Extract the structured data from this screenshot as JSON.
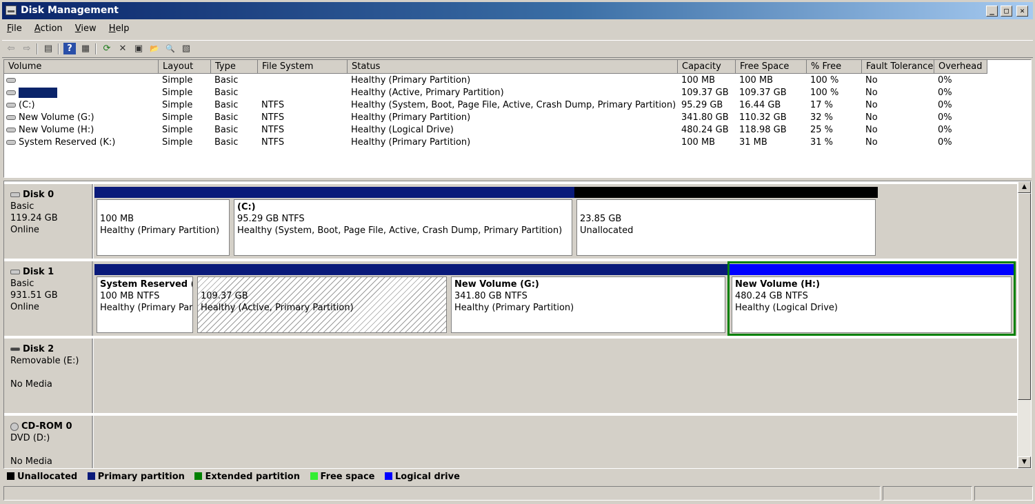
{
  "window": {
    "title": "Disk Management",
    "minimize": "_",
    "maximize": "□",
    "close": "✕"
  },
  "menu": [
    {
      "label": "File",
      "accel": "F",
      "rest": "ile"
    },
    {
      "label": "Action",
      "accel": "A",
      "rest": "ction"
    },
    {
      "label": "View",
      "accel": "V",
      "rest": "iew"
    },
    {
      "label": "Help",
      "accel": "H",
      "rest": "elp"
    }
  ],
  "toolbar": {
    "icons": [
      "back-icon",
      "forward-icon",
      "console-tree-icon",
      "help-icon",
      "properties-pane-icon",
      "refresh-icon",
      "delete-icon",
      "properties-icon",
      "open-icon",
      "explore-icon",
      "help-topics-icon"
    ],
    "glyphs": {
      "back": "⇦",
      "forward": "⇨",
      "tree": "▤",
      "help": "?",
      "pane": "▦",
      "refresh": "⟳",
      "delete": "✕",
      "props": "▣",
      "open": "📂",
      "explore": "🔍",
      "topics": "▧"
    }
  },
  "volume_table": {
    "columns": [
      "Volume",
      "Layout",
      "Type",
      "File System",
      "Status",
      "Capacity",
      "Free Space",
      "% Free",
      "Fault Tolerance",
      "Overhead"
    ],
    "rows": [
      {
        "volume": "",
        "layout": "Simple",
        "type": "Basic",
        "fs": "",
        "status": "Healthy (Primary Partition)",
        "capacity": "100 MB",
        "free": "100 MB",
        "pct": "100 %",
        "fault": "No",
        "overhead": "0%"
      },
      {
        "volume": "",
        "layout": "Simple",
        "type": "Basic",
        "fs": "",
        "status": "Healthy (Active, Primary Partition)",
        "capacity": "109.37 GB",
        "free": "109.37 GB",
        "pct": "100 %",
        "fault": "No",
        "overhead": "0%"
      },
      {
        "volume": "(C:)",
        "layout": "Simple",
        "type": "Basic",
        "fs": "NTFS",
        "status": "Healthy (System, Boot, Page File, Active, Crash Dump, Primary Partition)",
        "capacity": "95.29 GB",
        "free": "16.44 GB",
        "pct": "17 %",
        "fault": "No",
        "overhead": "0%"
      },
      {
        "volume": "New Volume (G:)",
        "layout": "Simple",
        "type": "Basic",
        "fs": "NTFS",
        "status": "Healthy (Primary Partition)",
        "capacity": "341.80 GB",
        "free": "110.32 GB",
        "pct": "32 %",
        "fault": "No",
        "overhead": "0%"
      },
      {
        "volume": "New Volume (H:)",
        "layout": "Simple",
        "type": "Basic",
        "fs": "NTFS",
        "status": "Healthy (Logical Drive)",
        "capacity": "480.24 GB",
        "free": "118.98 GB",
        "pct": "25 %",
        "fault": "No",
        "overhead": "0%"
      },
      {
        "volume": "System Reserved (K:)",
        "layout": "Simple",
        "type": "Basic",
        "fs": "NTFS",
        "status": "Healthy (Primary Partition)",
        "capacity": "100 MB",
        "free": "31 MB",
        "pct": "31 %",
        "fault": "No",
        "overhead": "0%"
      }
    ]
  },
  "disks": [
    {
      "name": "Disk 0",
      "line1": "Basic",
      "line2": "119.24 GB",
      "line3": "Online",
      "partitions": [
        {
          "name": "",
          "size": "100 MB",
          "status": "Healthy (Primary Partition)",
          "bar": "primary"
        },
        {
          "name": "(C:)",
          "size": "95.29 GB NTFS",
          "status": "Healthy (System, Boot, Page File, Active, Crash Dump, Primary Partition)",
          "bar": "primary"
        },
        {
          "name": "",
          "size": "23.85 GB",
          "status": "Unallocated",
          "bar": "unallocated"
        }
      ]
    },
    {
      "name": "Disk 1",
      "line1": "Basic",
      "line2": "931.51 GB",
      "line3": "Online",
      "partitions": [
        {
          "name": "System Reserved  (",
          "size": "100 MB NTFS",
          "status": "Healthy (Primary Partition)",
          "bar": "primary"
        },
        {
          "name": "",
          "size": "109.37 GB",
          "status": "Healthy (Active, Primary Partition)",
          "bar": "primary"
        },
        {
          "name": "New Volume  (G:)",
          "size": "341.80 GB NTFS",
          "status": "Healthy (Primary Partition)",
          "bar": "primary"
        },
        {
          "name": "New Volume  (H:)",
          "size": "480.24 GB NTFS",
          "status": "Healthy (Logical Drive)",
          "bar": "logical"
        }
      ]
    },
    {
      "name": "Disk 2",
      "line1": "Removable (E:)",
      "line2": "",
      "line3": "No Media"
    },
    {
      "name": "CD-ROM 0",
      "line1": "DVD (D:)",
      "line2": "",
      "line3": "No Media"
    }
  ],
  "legend": [
    {
      "label": "Unallocated",
      "color": "#000000"
    },
    {
      "label": "Primary partition",
      "color": "#0a1a7a"
    },
    {
      "label": "Extended partition",
      "color": "#008000"
    },
    {
      "label": "Free space",
      "color": "#33ee33"
    },
    {
      "label": "Logical drive",
      "color": "#0000ff"
    }
  ],
  "colors": {
    "primary": "#0a1a7a",
    "logical": "#0000ff",
    "unallocated": "#000000",
    "extended_outline": "#008000",
    "title_start": "#0a246a"
  }
}
